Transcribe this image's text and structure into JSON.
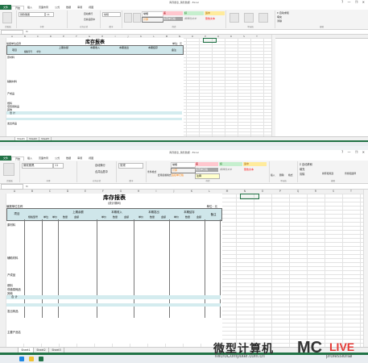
{
  "window": {
    "title": "库存报表_销售数据 - Excel",
    "controls": [
      "?",
      "—",
      "❐",
      "✕"
    ]
  },
  "ribbon": {
    "file_tab": "文件",
    "tabs": [
      "开始",
      "插入",
      "页面布局",
      "公式",
      "数据",
      "审阅",
      "视图"
    ],
    "font_name": "微软雅黑",
    "font_size": "11",
    "wrap_text": "自动换行",
    "merge_center": "合并后居中",
    "number_format": "常规",
    "styles": {
      "normal": "常规",
      "bad": "差",
      "good": "好",
      "neutral": "适中",
      "calculation": "计算",
      "check_cell": "检查单元格",
      "explanatory": "解释性文本",
      "warning": "警告文本",
      "linked": "链接单元格",
      "note": "注释"
    },
    "conditional_format": "条件格式",
    "table_format": "套用表格格式",
    "insert": "插入",
    "delete": "删除",
    "format": "格式",
    "autosum": "Σ 自动求和",
    "fill": "填充",
    "clear": "清除",
    "sort_filter": "排序和筛选",
    "find_select": "查找和选择",
    "groups": [
      "剪贴板",
      "字体",
      "对齐方式",
      "数字",
      "样式",
      "单元格",
      "编辑"
    ]
  },
  "formula_bar": {
    "name_box": "",
    "fx": "fx",
    "content": ""
  },
  "columns": [
    "A",
    "B",
    "C",
    "D",
    "E",
    "F",
    "G",
    "H",
    "I",
    "J",
    "K",
    "L",
    "M",
    "N",
    "O",
    "P",
    "Q",
    "R",
    "S",
    "T"
  ],
  "report": {
    "title": "库存报表",
    "subtitle": "(统计期间)",
    "unit_label": "编报单位名称",
    "unit_right": "单位：元",
    "col_item": "项目",
    "group_headers": [
      "上期余额",
      "本期收入",
      "本期发出",
      "本期结存"
    ],
    "col_subhead_first": "规格型号",
    "col_subhead_unit": "单位",
    "col_subheads": [
      "单价",
      "数量",
      "金额"
    ],
    "col_remark": "备注",
    "row_labels": [
      "原材料",
      "辅助材料",
      "产成品",
      "半成品",
      "燃料",
      "低值易耗品",
      "其他",
      "合  计",
      "发出商品"
    ],
    "extra_label": "主要产品名"
  },
  "sheets": [
    "Sheet1",
    "Sheet2",
    "Sheet3"
  ],
  "watermark": {
    "cn": "微型计算机",
    "site": "MicroComputer.com.cn",
    "logo": "MC",
    "suffix": "LIVE",
    "tag": "professional"
  }
}
